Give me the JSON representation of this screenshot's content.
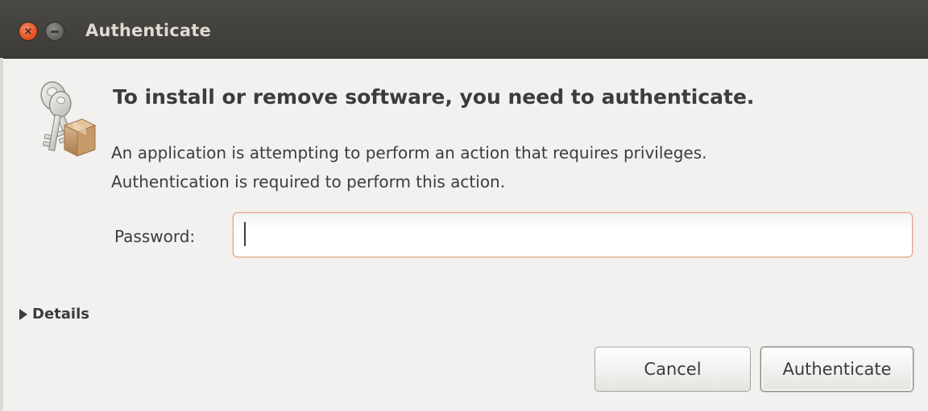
{
  "window": {
    "title": "Authenticate",
    "close_symbol": "×"
  },
  "dialog": {
    "icon": "keys-package-icon",
    "headline": "To install or remove software, you need to authenticate.",
    "message_line1": "An application is attempting to perform an action that requires privileges.",
    "message_line2": "Authentication is required to perform this action.",
    "password_label": "Password:",
    "password_value": "",
    "details_label": "Details",
    "cancel_label": "Cancel",
    "authenticate_label": "Authenticate"
  },
  "colors": {
    "titlebar": "#3c3b37",
    "close_button": "#df4a16",
    "input_focus_border": "#e5a08a",
    "background": "#f2f1f0"
  }
}
